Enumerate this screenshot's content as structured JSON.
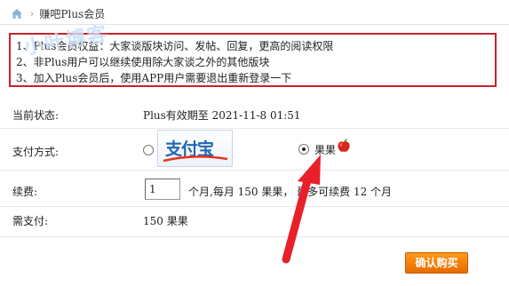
{
  "breadcrumb": {
    "current": "赚吧Plus会员"
  },
  "notice": {
    "lines": [
      "1、Plus会员权益：大家谈版块访问、发帖、回复，更高的阅读权限",
      "2、非Plus用户可以继续使用除大家谈之外的其他版块",
      "3、加入Plus会员后，使用APP用户需要退出重新登录一下"
    ]
  },
  "watermark": "小叶博客",
  "status": {
    "label": "当前状态:",
    "value": "Plus有效期至 2021-11-8 01:51"
  },
  "payment": {
    "label": "支付方式:",
    "alipay_text": "支付宝",
    "alipay_selected": false,
    "points_label": "果果",
    "points_selected": true
  },
  "renew": {
    "label": "续费:",
    "quantity": "1",
    "suffix": "个月,每月 150 果果， 最多可续费 12 个月"
  },
  "due": {
    "label": "需支付:",
    "value": "150 果果"
  },
  "confirm_button": "确认购买",
  "colors": {
    "notice_border": "#c8202a",
    "button": "#f08a10",
    "arrow": "#e8202a",
    "alipay": "#1c67b5"
  },
  "icons": {
    "home": "home-icon",
    "apple": "apple-icon",
    "arrow": "annotation-arrow"
  }
}
